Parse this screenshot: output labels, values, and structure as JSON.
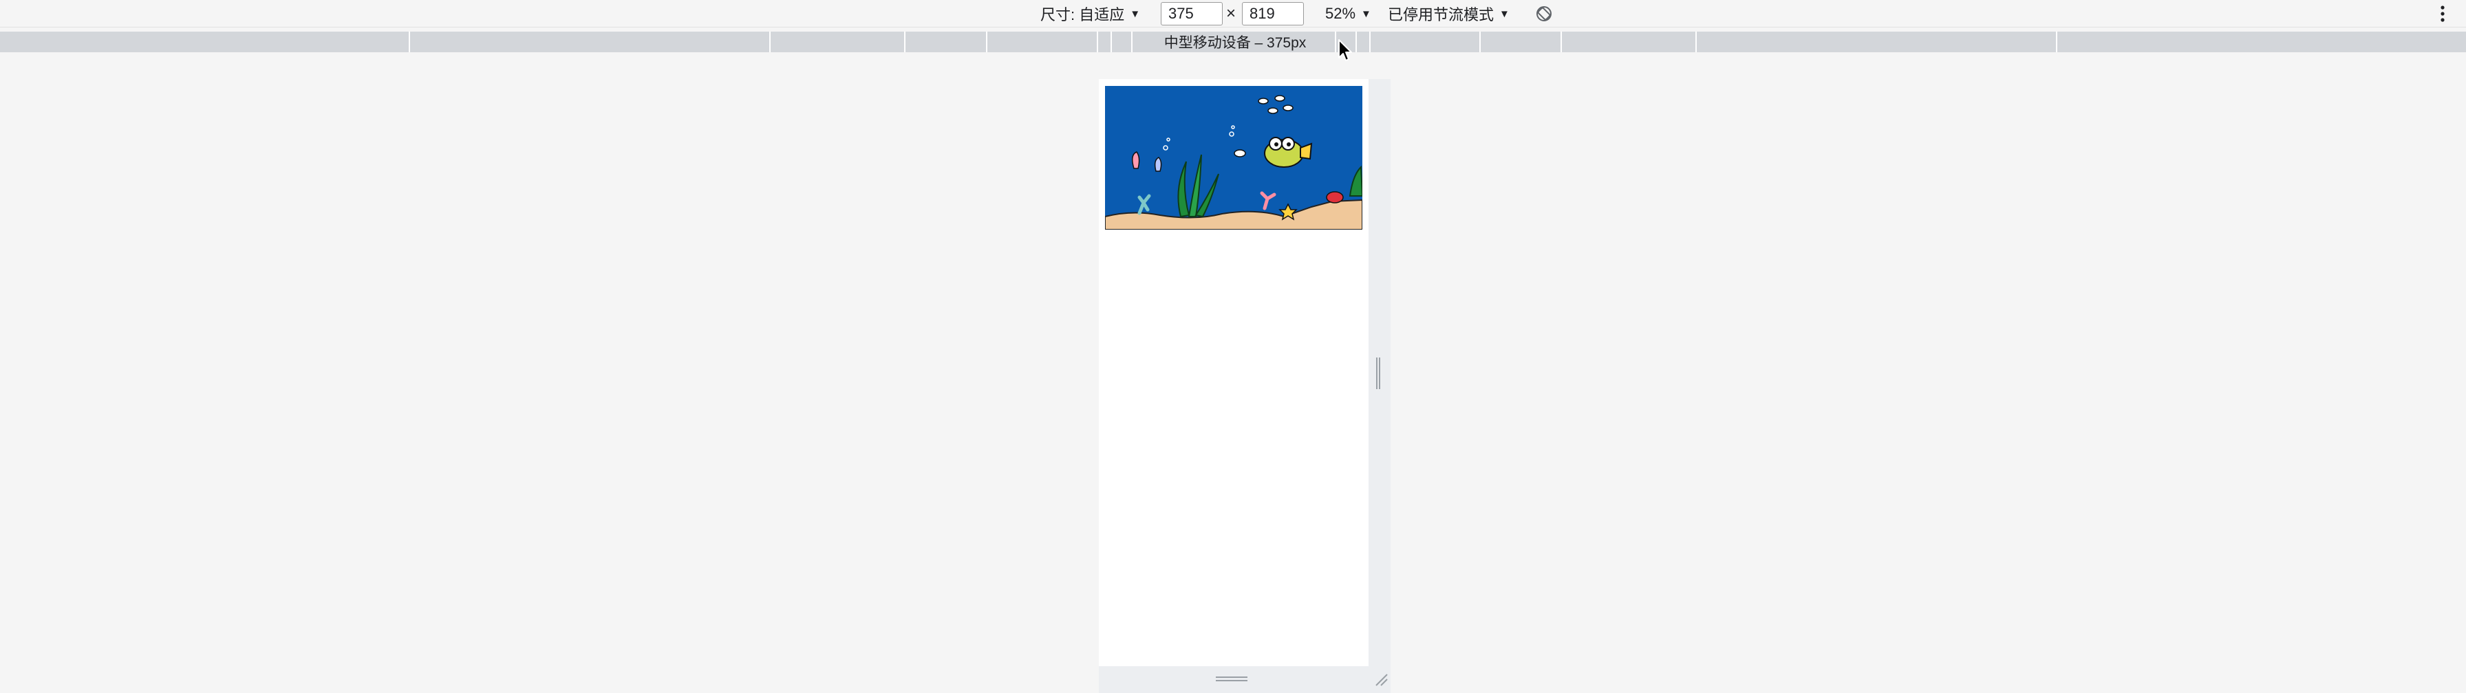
{
  "toolbar": {
    "dimensions_label": "尺寸: 自适应",
    "width_value": "375",
    "times_symbol": "×",
    "height_value": "819",
    "zoom_label": "52%",
    "throttle_label": "已停用节流模式",
    "rotate_icon": "rotate-disabled-icon",
    "more_icon": "more-vertical-icon"
  },
  "media_query": {
    "label": "中型移动设备 – 375px"
  },
  "device": {
    "banner_alt": "underwater-illustration"
  }
}
